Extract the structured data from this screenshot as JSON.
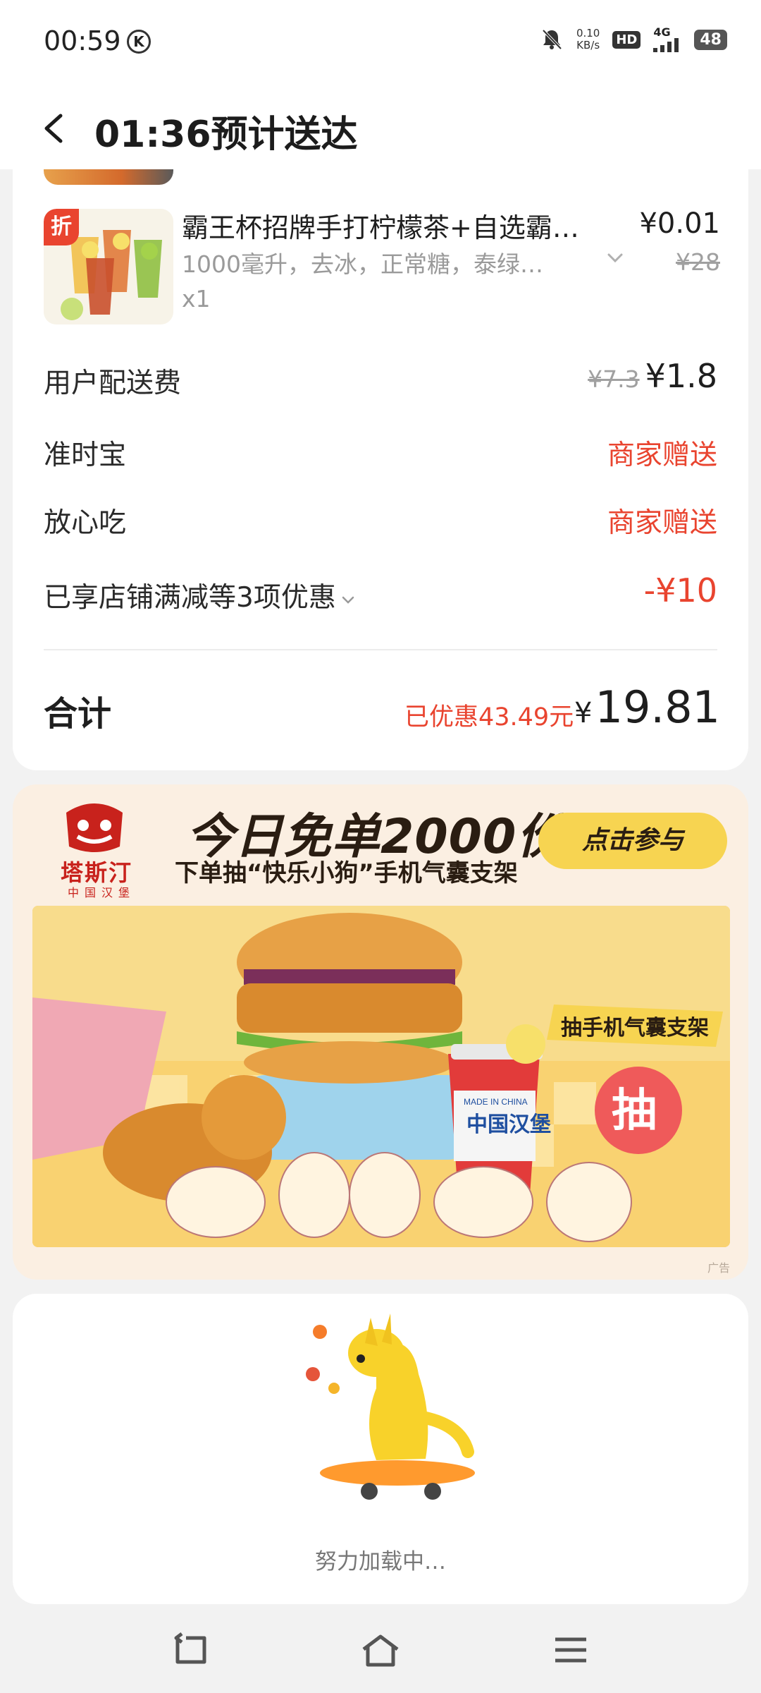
{
  "status_bar": {
    "time": "00:59",
    "k_badge": "K",
    "net_speed_value": "0.10",
    "net_speed_unit": "KB/s",
    "hd": "HD",
    "network": "4G",
    "battery": "48",
    "icons": [
      "mute-bell-icon",
      "signal-icon",
      "battery-icon"
    ]
  },
  "header": {
    "title": "01:36预计送达",
    "back_icon": "chevron-left-icon"
  },
  "order": {
    "item": {
      "badge": "折",
      "name": "霸王杯招牌手打柠檬茶+自选霸…",
      "spec": "1000毫升，去冰，正常糖，泰绿…",
      "qty": "x1",
      "price": "¥0.01",
      "original_price": "¥28"
    },
    "rows": [
      {
        "label": "用户配送费",
        "original": "¥7.3",
        "value": "¥1.8"
      },
      {
        "label": "准时宝",
        "value": "商家赠送"
      },
      {
        "label": "放心吃",
        "value": "商家赠送"
      },
      {
        "label": "已享店铺满减等3项优惠",
        "value": "-¥10"
      }
    ],
    "total": {
      "label": "合计",
      "saved": "已优惠43.49元",
      "currency": "¥",
      "value": "19.81"
    }
  },
  "ad": {
    "brand": "塔斯汀",
    "brand_sub": "中国汉堡",
    "headline": "今日免单2000份",
    "subline": "下单抽“快乐小狗”手机气囊支架",
    "cta": "点击参与",
    "banner_ribbon": "抽手机气囊支架",
    "banner_badge": "抽",
    "cup_text_top": "MADE IN CHINA",
    "cup_text_main": "中国汉堡",
    "ad_tag": "广告"
  },
  "loading": {
    "text": "努力加载中…"
  },
  "nav": {
    "icons": [
      "back-nav-icon",
      "home-nav-icon",
      "menu-nav-icon"
    ]
  },
  "colors": {
    "accent_red": "#e9442f",
    "ad_yellow": "#f7d451",
    "brand_red": "#c8221c"
  }
}
